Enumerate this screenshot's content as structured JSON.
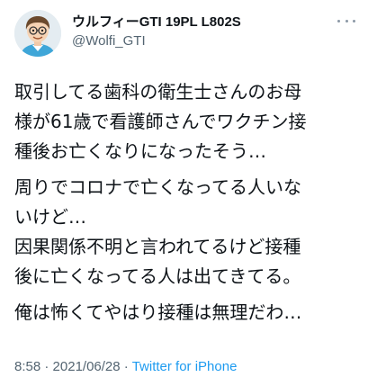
{
  "user": {
    "display_name": "ウルフィーGTI 19PL L802S",
    "handle": "@Wolfi_GTI",
    "avatar_icon": "cartoon-avatar"
  },
  "more_icon": "more-dots-icon",
  "tweet": {
    "lines": [
      "取引してる歯科の衛生士さんのお母",
      "様が61歳で看護師さんでワクチン接",
      "種後お亡くなりになったそう…",
      "周りでコロナで亡くなってる人いな",
      "いけど…",
      "因果関係不明と言われてるけど接種",
      "後に亡くなってる人は出てきてる。",
      "俺は怖くてやはり接種は無理だわ…"
    ]
  },
  "meta": {
    "time": "8:58",
    "separator": " · ",
    "date": "2021/06/28",
    "source": "Twitter for iPhone"
  },
  "colors": {
    "text": "#0f1419",
    "secondary": "#536471",
    "link": "#1d9bf0"
  }
}
